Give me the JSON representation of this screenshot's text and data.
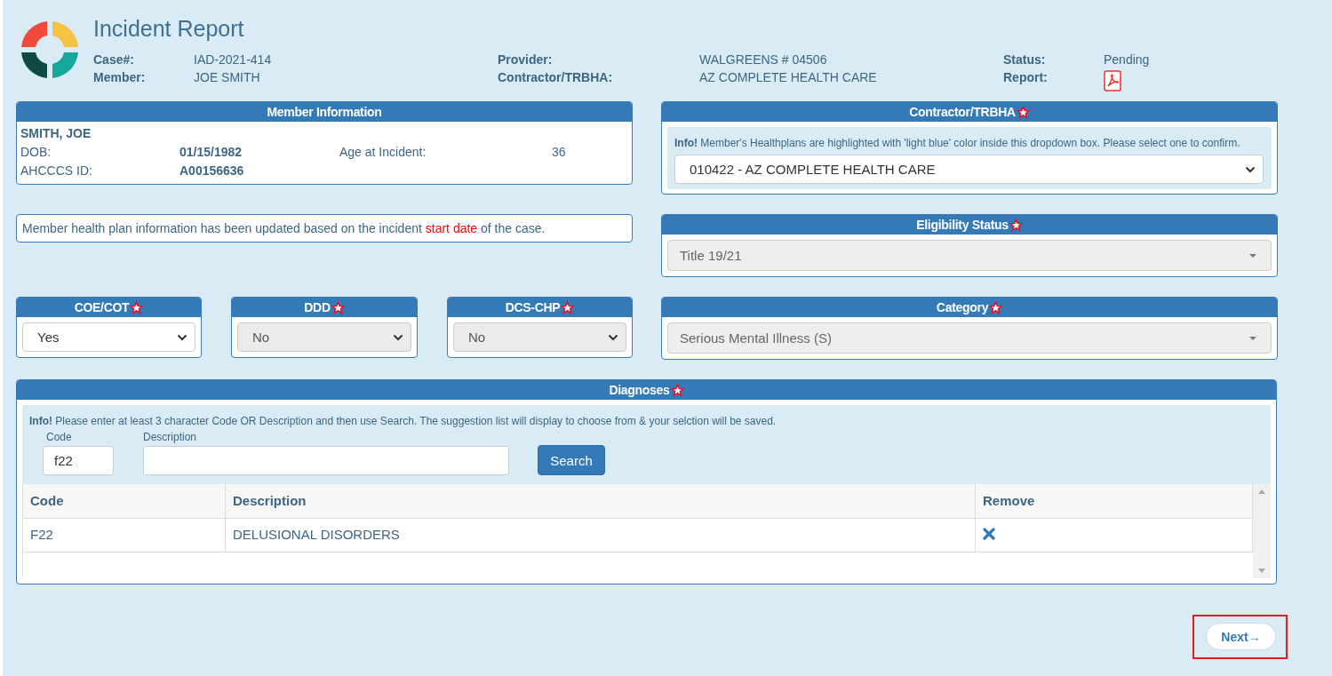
{
  "header": {
    "title": "Incident Report",
    "fields": [
      {
        "label": "Case#:",
        "kind": "text",
        "value": "IAD-2021-414"
      },
      {
        "label": "Provider:",
        "kind": "text",
        "value": "WALGREENS # 04506"
      },
      {
        "label": "Status:",
        "kind": "text",
        "value": "Pending"
      },
      {
        "label": "Member:",
        "kind": "text",
        "value": "JOE SMITH"
      },
      {
        "label": "Contractor/TRBHA:",
        "kind": "text",
        "value": "AZ COMPLETE HEALTH CARE"
      },
      {
        "label": "Report:",
        "kind": "pdf"
      }
    ]
  },
  "member_information": {
    "title": "Member Information",
    "name": "SMITH, JOE",
    "fields": [
      {
        "label": "DOB:",
        "value": "01/15/1982",
        "bold": true
      },
      {
        "label": "Age at Incident:",
        "value": "36",
        "bold": false
      },
      {
        "label": "AHCCCS ID:",
        "value": "A00156636",
        "bold": true
      }
    ]
  },
  "notice": {
    "segments": [
      {
        "text": "Member health plan information has been updated based on the incident ",
        "highlight": false
      },
      {
        "text": "start date",
        "highlight": true
      },
      {
        "text": " of the case.",
        "highlight": false
      }
    ]
  },
  "flags": [
    {
      "title": "COE/COT",
      "required": true,
      "value": "Yes",
      "disabled": false
    },
    {
      "title": "DDD",
      "required": true,
      "value": "No",
      "disabled": true
    },
    {
      "title": "DCS-CHP",
      "required": true,
      "value": "No",
      "disabled": true
    }
  ],
  "contractor": {
    "title": "Contractor/TRBHA",
    "required": true,
    "info": "**Info!** Member's Healthplans are highlighted with 'light blue' color inside this dropdown box. Please select one to confirm.",
    "value": "010422 - AZ COMPLETE HEALTH CARE",
    "disabled": false
  },
  "eligibility_status": {
    "title": "Eligibility Status",
    "required": true,
    "value": "Title 19/21",
    "disabled": true
  },
  "category": {
    "title": "Category",
    "required": true,
    "value": "Serious Mental Illness (S)",
    "disabled": true
  },
  "diagnoses": {
    "title": "Diagnoses",
    "required": true,
    "info": "**Info!** Please enter at least 3 character Code OR Description and then use Search. The suggestion list will display to choose from & your selction will be saved.",
    "code_label": "Code",
    "code_value": "f22",
    "description_label": "Description",
    "search_button": "Search",
    "table": {
      "columns": [
        "Code",
        "Description",
        "Remove"
      ],
      "rows": [
        {
          "code": "F22",
          "description": "DELUSIONAL DISORDERS"
        }
      ]
    }
  },
  "next_button": {
    "label": "Next→",
    "highlighted": true
  }
}
